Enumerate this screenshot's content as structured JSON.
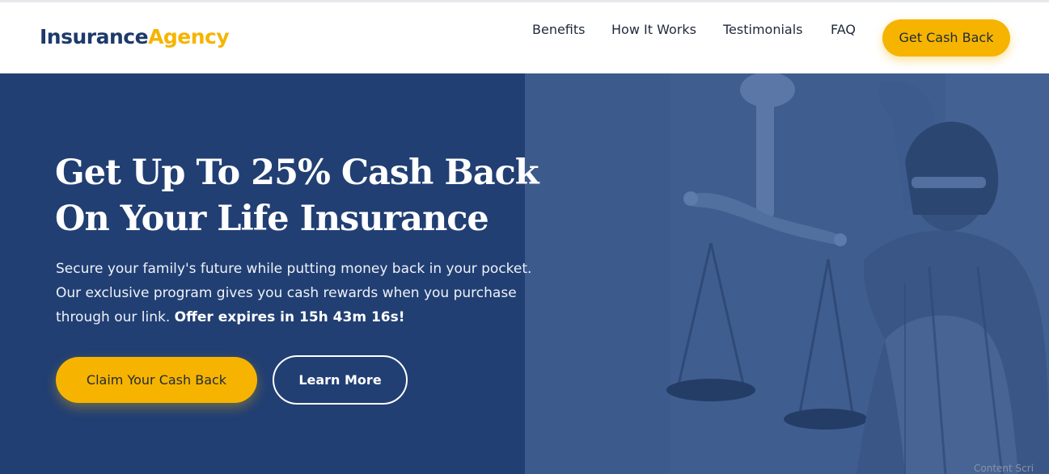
{
  "header": {
    "logo_part1": "Insurance",
    "logo_part2": "Agency",
    "nav": [
      "Benefits",
      "How It Works",
      "Testimonials",
      "FAQ"
    ],
    "cta_label": "Get Cash Back"
  },
  "hero": {
    "title_line1": "Get Up To 25% Cash Back",
    "title_line2": "On Your Life Insurance",
    "subtitle": "Secure your family's future while putting money back in your pocket. Our exclusive program gives you cash rewards when you purchase through our link.",
    "offer_text": "Offer expires in 15h 43m 16s!",
    "primary_button": "Claim Your Cash Back",
    "secondary_button": "Learn More",
    "image_icon": "lady-justice-statue"
  },
  "overlay_text": "Content Scri",
  "colors": {
    "brand_navy": "#1d3a6b",
    "brand_gold": "#f6b400",
    "hero_bg": "#213f73",
    "hero_image_tint": "#405d8f"
  }
}
